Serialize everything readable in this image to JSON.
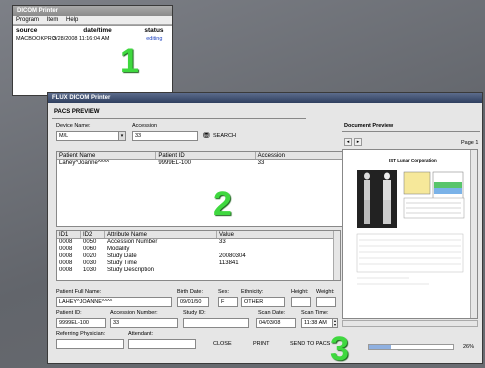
{
  "small_window": {
    "title": "DICOM Printer",
    "menu": [
      "Program",
      "Item",
      "Help"
    ],
    "columns": [
      "source",
      "date/time",
      "status"
    ],
    "rows": [
      {
        "source": "MACBOOKPRO",
        "datetime": "3/28/2008 11:16:04 AM",
        "status": "editing"
      }
    ]
  },
  "main_window": {
    "title": "FLUX DICOM Printer",
    "tab": "PACS PREVIEW",
    "device_label": "Device Name:",
    "device_value": "M/L",
    "accession_label": "Accession",
    "accession_value": "33",
    "search_label": "SEARCH",
    "patient_table": {
      "columns": [
        "Patient Name",
        "Patient ID",
        "Accession"
      ],
      "rows": [
        [
          "Lahey^Joanne^^^^",
          "9999EL-100",
          "33"
        ]
      ]
    },
    "attr_table": {
      "columns": [
        "ID1",
        "ID2",
        "Attribute Name",
        "Value"
      ],
      "rows": [
        [
          "0008",
          "0050",
          "Accession Number",
          "33"
        ],
        [
          "0008",
          "0060",
          "Modality",
          ""
        ],
        [
          "0008",
          "0020",
          "Study Date",
          "20080304"
        ],
        [
          "0008",
          "0030",
          "Study Time",
          "113841"
        ],
        [
          "0008",
          "1030",
          "Study Description",
          ""
        ]
      ]
    },
    "form": {
      "full_name_label": "Patient Full Name:",
      "full_name": "LAHEY^JOANNE^^^^",
      "birth_label": "Birth Date:",
      "birth": "09/01/50",
      "sex_label": "Sex:",
      "sex": "F",
      "ethnicity_label": "Ethnicity:",
      "ethnicity": "OTHER",
      "height_label": "Height:",
      "weight_label": "Weight:",
      "patient_id_label": "Patient ID:",
      "patient_id": "9999EL-100",
      "accession_label": "Accession Number:",
      "accession": "33",
      "study_id_label": "Study ID:",
      "scan_date_label": "Scan Date:",
      "scan_date": "04/03/08",
      "scan_time_label": "Scan Time:",
      "scan_time": "11:38 AM",
      "referring_label": "Referring Physician:",
      "attendant_label": "Attendant:"
    },
    "buttons": {
      "close": "CLOSE",
      "print": "PRINT",
      "send": "SEND TO PACS"
    },
    "progress_text": "26%",
    "progress": 0.26,
    "doc_preview_tab": "Document Preview",
    "page_label": "Page 1",
    "report_title": "IST Lunar Corporation"
  },
  "callouts": [
    "1",
    "2",
    "3"
  ],
  "colors": {
    "callout": "#3fd83f",
    "titlebar": "#2f3f5f",
    "status": "#1a3fbf"
  }
}
